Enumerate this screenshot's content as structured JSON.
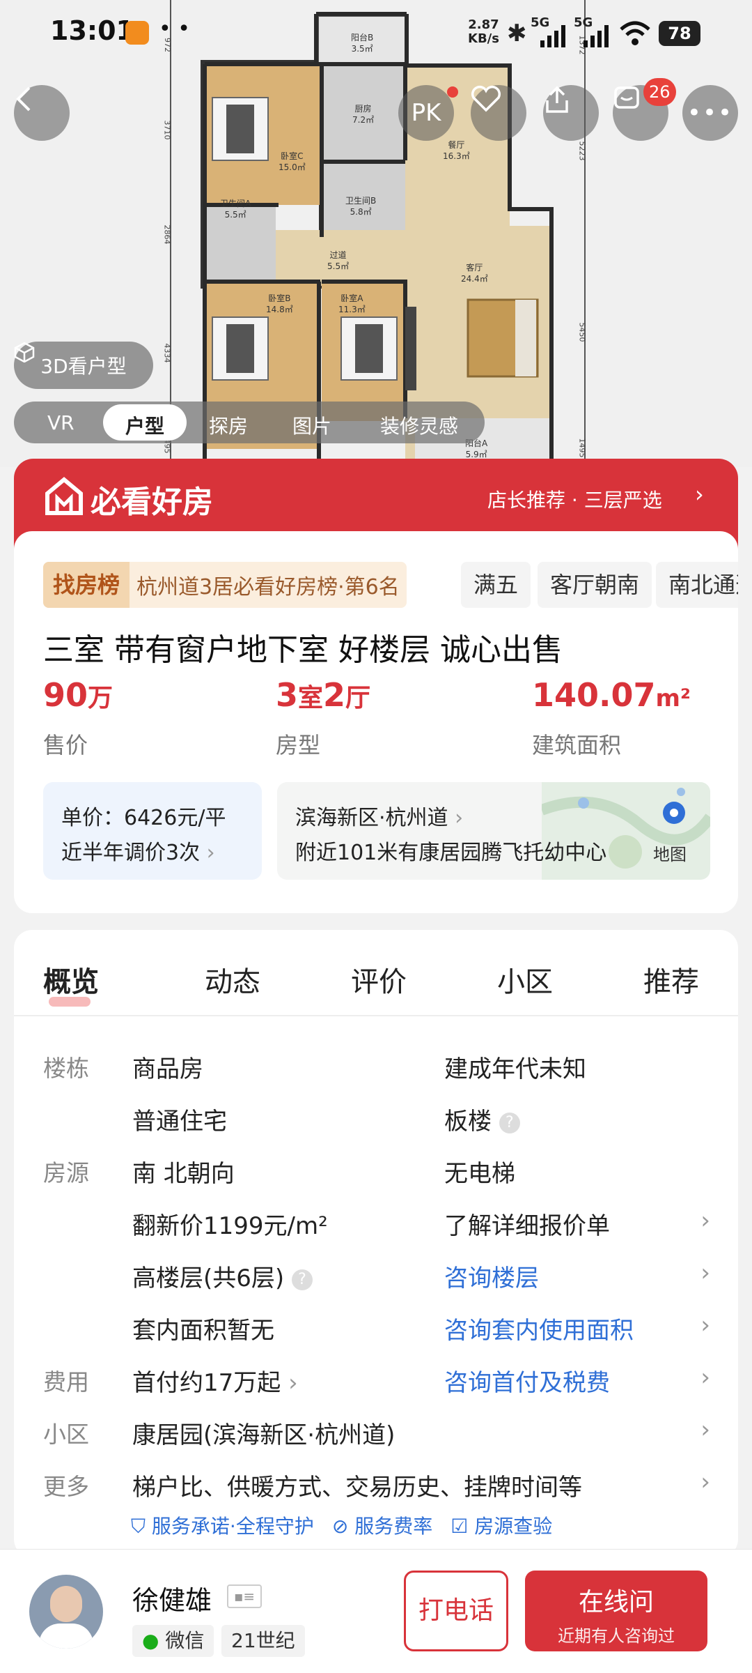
{
  "status": {
    "time": "13:01",
    "net_speed_top": "2.87",
    "net_speed_bottom": "KB/s",
    "net1": "5G",
    "net2": "5G",
    "battery": "78"
  },
  "floorplan": {
    "rooms": {
      "balcony_b": "阳台B",
      "balcony_b_area": "3.5㎡",
      "kitchen": "厨房",
      "kitchen_area": "7.2㎡",
      "bedroom_c": "卧室C",
      "bedroom_c_area": "15.0㎡",
      "dining": "餐厅",
      "dining_area": "16.3㎡",
      "bath_a": "卫生间A",
      "bath_a_area": "5.5㎡",
      "bath_b": "卫生间B",
      "bath_b_area": "5.8㎡",
      "corridor": "过道",
      "corridor_area": "5.5㎡",
      "living": "客厅",
      "living_area": "24.4㎡",
      "bedroom_b": "卧室B",
      "bedroom_b_area": "14.8㎡",
      "bedroom_a": "卧室A",
      "bedroom_a_area": "11.3㎡",
      "balcony_a": "阳台A",
      "balcony_a_area": "5.9㎡"
    },
    "dims": {
      "d1": "972",
      "d2": "3710",
      "d3": "2864",
      "d4": "4334",
      "d5": "1495",
      "d6": "1372",
      "d7": "5223",
      "d8": "5450",
      "d9": "1495"
    }
  },
  "header_buttons": {
    "pk_label": "PK",
    "message_badge": "26"
  },
  "view3d_label": "3D看户型",
  "media_tabs": [
    "VR",
    "户型",
    "探房",
    "图片",
    "装修灵感"
  ],
  "media_tab_active": 1,
  "banner": {
    "title": "必看好房",
    "right_text": "店长推荐 · 三层严选"
  },
  "rank": {
    "badge": "找房榜",
    "text": "杭州道3居必看好房榜·第6名"
  },
  "tags": [
    "满五",
    "客厅朝南",
    "南北通透"
  ],
  "listing": {
    "title": "三室 带有窗户地下室 好楼层 诚心出售",
    "price_value": "90",
    "price_unit": "万",
    "price_label": "售价",
    "layout_shi": "3",
    "layout_shi_unit": "室",
    "layout_ting": "2",
    "layout_ting_unit": "厅",
    "layout_label": "房型",
    "area_value": "140.07",
    "area_unit": "m²",
    "area_label": "建筑面积",
    "unit_price": "单价：6426元/平",
    "price_adjust": "近半年调价3次",
    "location": "滨海新区·杭州道",
    "nearby": "附近101米有康居园腾飞托幼中心",
    "map_label": "地图"
  },
  "detail_tabs": [
    "概览",
    "动态",
    "评价",
    "小区",
    "推荐"
  ],
  "detail": {
    "lbl_building": "楼栋",
    "building_type": "商品房",
    "build_year": "建成年代未知",
    "house_type": "普通住宅",
    "structure": "板楼",
    "lbl_source": "房源",
    "orientation": "南 北朝向",
    "elevator": "无电梯",
    "renovate_price": "翻新价1199元/m²",
    "renovate_link": "了解详细报价单",
    "floor": "高楼层(共6层)",
    "floor_link": "咨询楼层",
    "inner_area": "套内面积暂无",
    "inner_area_link": "咨询套内使用面积",
    "lbl_cost": "费用",
    "down_payment": "首付约17万起",
    "down_payment_link": "咨询首付及税费",
    "lbl_community": "小区",
    "community": "康居园(滨海新区·杭州道)",
    "lbl_more": "更多",
    "more": "梯户比、供暖方式、交易历史、挂牌时间等"
  },
  "services": [
    "服务承诺·全程守护",
    "服务费率",
    "房源查验"
  ],
  "agent": {
    "name": "徐健雄",
    "wechat": "微信",
    "company": "21世纪"
  },
  "actions": {
    "call": "打电话",
    "online": "在线问",
    "online_sub": "近期有人咨询过"
  },
  "colors": {
    "brand_red": "#d8333a",
    "link_blue": "#2f6fd6"
  }
}
